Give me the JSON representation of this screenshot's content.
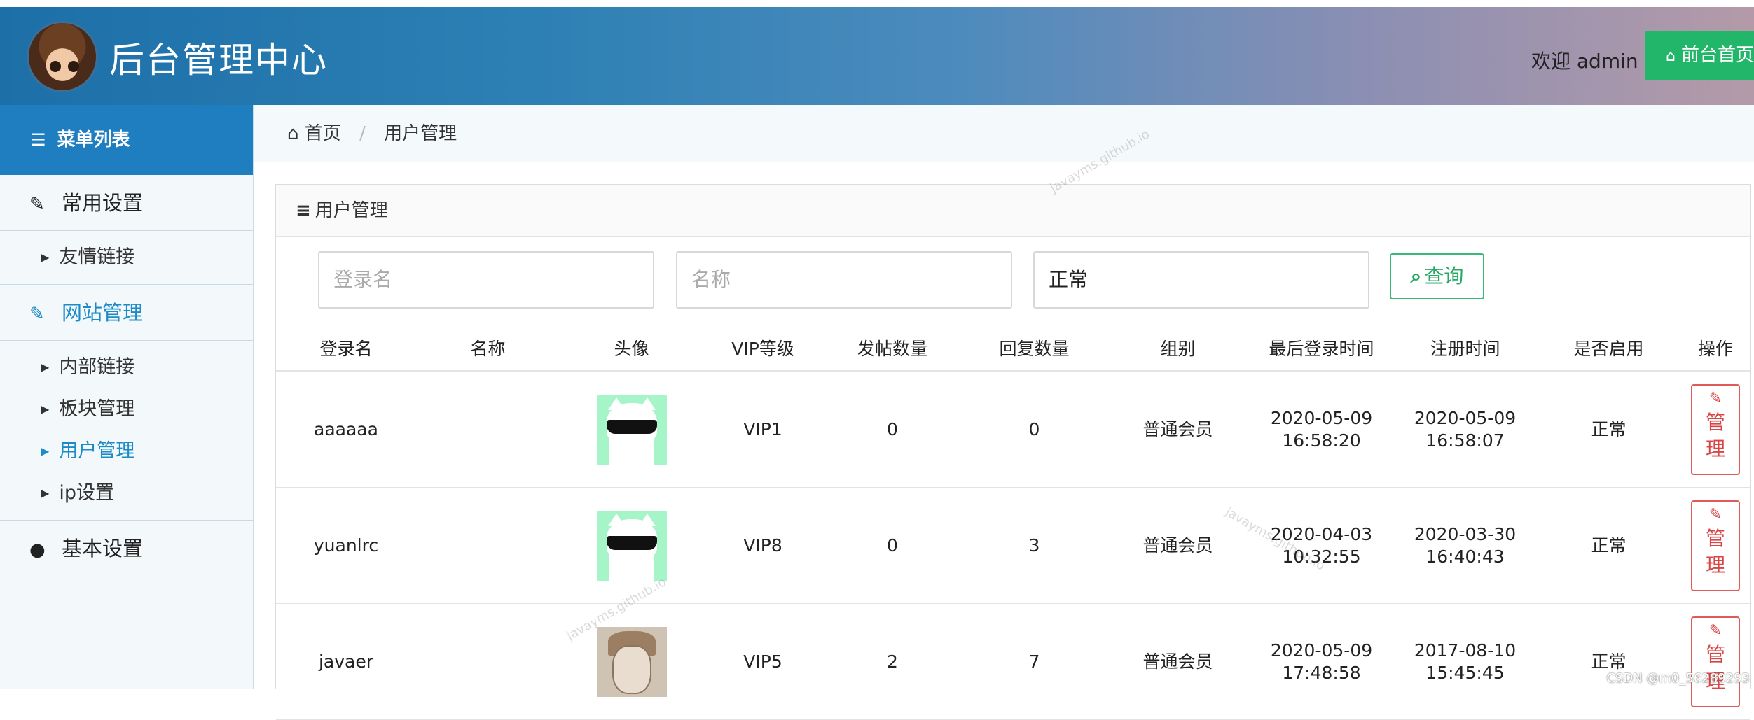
{
  "header": {
    "title": "后台管理中心",
    "welcome": "欢迎 admin",
    "front_button": "前台首页"
  },
  "sidebar": {
    "menu_title": "菜单列表",
    "groups": [
      {
        "label": "常用设置",
        "items": [
          "友情链接"
        ]
      },
      {
        "label": "网站管理",
        "items": [
          "内部链接",
          "板块管理",
          "用户管理",
          "ip设置"
        ]
      },
      {
        "label": "基本设置",
        "items": []
      }
    ]
  },
  "breadcrumb": {
    "home": "首页",
    "current": "用户管理"
  },
  "panel": {
    "title": "用户管理",
    "search": {
      "login_placeholder": "登录名",
      "name_placeholder": "名称",
      "status_value": "正常",
      "query_button": "查询"
    },
    "table": {
      "headers": [
        "登录名",
        "名称",
        "头像",
        "VIP等级",
        "发帖数量",
        "回复数量",
        "组别",
        "最后登录时间",
        "注册时间",
        "是否启用",
        "操作"
      ],
      "rows": [
        {
          "login": "aaaaaa",
          "name": "",
          "avatar": "cat-sunglasses",
          "vip": "VIP1",
          "posts": "0",
          "replies": "0",
          "group": "普通会员",
          "last_login_date": "2020-05-09",
          "last_login_time": "16:58:20",
          "reg_date": "2020-05-09",
          "reg_time": "16:58:07",
          "status": "正常",
          "action": "管理"
        },
        {
          "login": "yuanlrc",
          "name": "",
          "avatar": "cat-sunglasses",
          "vip": "VIP8",
          "posts": "0",
          "replies": "3",
          "group": "普通会员",
          "last_login_date": "2020-04-03",
          "last_login_time": "10:32:55",
          "reg_date": "2020-03-30",
          "reg_time": "16:40:43",
          "status": "正常",
          "action": "管理"
        },
        {
          "login": "javaer",
          "name": "",
          "avatar": "man-sketch",
          "vip": "VIP5",
          "posts": "2",
          "replies": "7",
          "group": "普通会员",
          "last_login_date": "2020-05-09",
          "last_login_time": "17:48:58",
          "reg_date": "2017-08-10",
          "reg_time": "15:45:45",
          "status": "正常",
          "action": "管理"
        }
      ]
    }
  },
  "watermark": "javayms.github.io",
  "csdn_credit": "CSDN @m0_56289293"
}
